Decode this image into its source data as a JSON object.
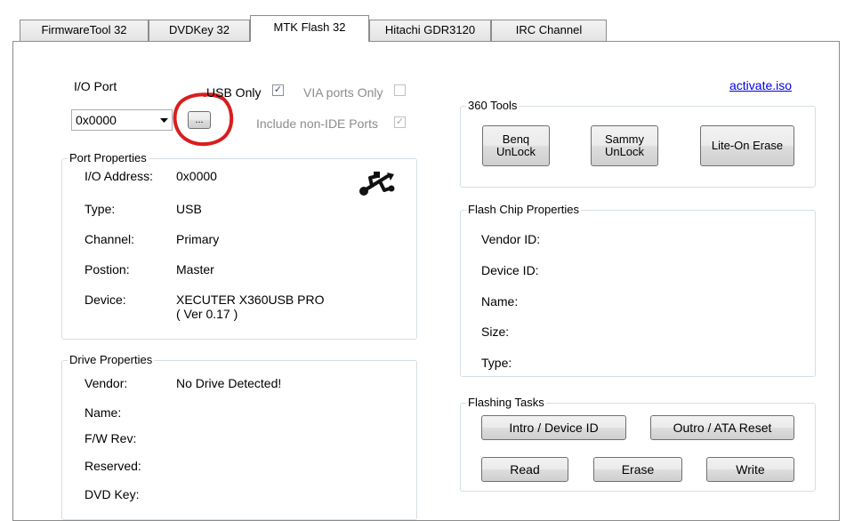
{
  "tabs": [
    {
      "label": "FirmwareTool 32"
    },
    {
      "label": "DVDKey 32"
    },
    {
      "label": "MTK Flash 32"
    },
    {
      "label": "Hitachi GDR3120"
    },
    {
      "label": "IRC Channel"
    }
  ],
  "active_tab": "MTK Flash 32",
  "io_port": {
    "label": "I/O Port",
    "value": "0x0000",
    "browse_label": "...",
    "usb_only_label": "USB Only",
    "usb_only_checked": true,
    "via_ports_only_label": "VIA ports Only",
    "via_ports_only_checked": false,
    "include_non_ide_label": "Include non-IDE Ports",
    "include_non_ide_checked": true
  },
  "activate_link": "activate.iso",
  "port_properties": {
    "title": "Port Properties",
    "rows": [
      {
        "label": "I/O Address:",
        "value": "0x0000"
      },
      {
        "label": "Type:",
        "value": "USB"
      },
      {
        "label": "Channel:",
        "value": "Primary"
      },
      {
        "label": "Postion:",
        "value": "Master"
      },
      {
        "label": "Device:",
        "value": "XECUTER X360USB PRO",
        "value2": "( Ver 0.17 )"
      }
    ],
    "icon": "usb-icon"
  },
  "drive_properties": {
    "title": "Drive Properties",
    "rows": [
      {
        "label": "Vendor:",
        "value": "No Drive Detected!"
      },
      {
        "label": "Name:",
        "value": ""
      },
      {
        "label": "F/W Rev:",
        "value": ""
      },
      {
        "label": "Reserved:",
        "value": ""
      },
      {
        "label": "DVD Key:",
        "value": ""
      }
    ]
  },
  "tools_360": {
    "title": "360 Tools",
    "buttons": [
      "Benq\nUnLock",
      "Sammy\nUnLock",
      "Lite-On Erase"
    ]
  },
  "flash_chip": {
    "title": "Flash Chip Properties",
    "rows": [
      "Vendor ID:",
      "Device ID:",
      "Name:",
      "Size:",
      "Type:"
    ]
  },
  "flashing_tasks": {
    "title": "Flashing Tasks",
    "intro_label": "Intro / Device ID",
    "outro_label": "Outro / ATA Reset",
    "read_label": "Read",
    "erase_label": "Erase",
    "write_label": "Write"
  },
  "colors": {
    "annotation_circle": "#d81e1e",
    "link": "#0000ee",
    "check": "#2a4a8a"
  }
}
